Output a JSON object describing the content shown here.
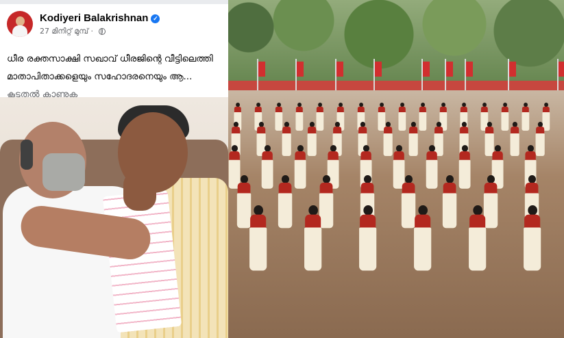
{
  "post": {
    "author": "Kodiyeri Balakrishnan",
    "time": "27 മിനിറ്റ് മുമ്പ്",
    "text": "ധീര രക്തസാക്ഷി സഖാവ് ധീരജിന്റെ വീട്ടിലെത്തി മാതാപിതാക്കളെയും സഹോദരനെയും ആ...",
    "see_more": "കൂടുതൽ കാണുക"
  },
  "icons": {
    "verified": "verified-badge-icon",
    "audience": "globe-icon"
  },
  "colors": {
    "verified_blue": "#1877f2",
    "meta_gray": "#65676b",
    "text_dark": "#050505"
  }
}
